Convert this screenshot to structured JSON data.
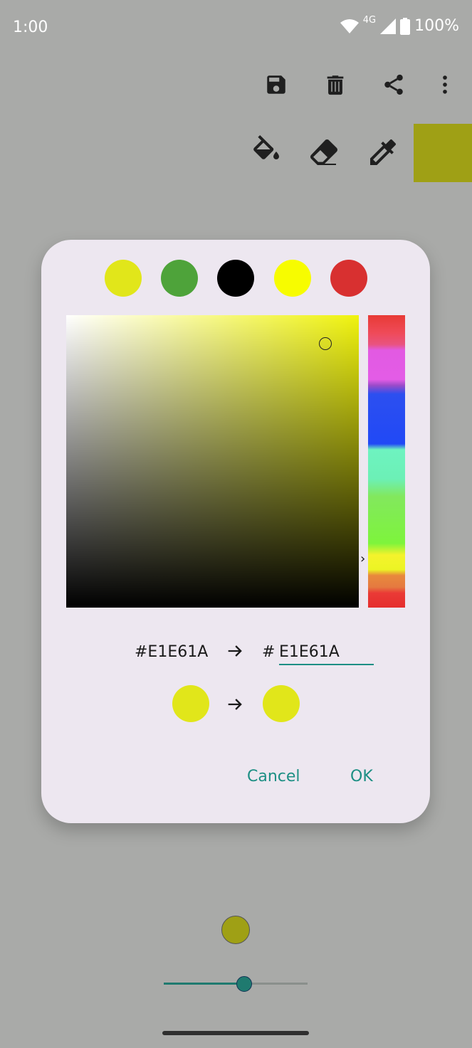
{
  "status_bar": {
    "time": "1:00",
    "network": "4G",
    "battery": "100%"
  },
  "toolbar": {
    "icons": [
      "save-icon",
      "delete-icon",
      "share-icon",
      "more-vert-icon"
    ]
  },
  "tools": {
    "icons": [
      "fill-bucket-icon",
      "eraser-icon",
      "eyedropper-icon"
    ],
    "current_color": "#9fa015"
  },
  "dialog": {
    "presets": [
      "#e1e61a",
      "#4ea33a",
      "#000000",
      "#f7fc00",
      "#d83030"
    ],
    "picker_hue": "#f0f30e",
    "old_hex": "#E1E61A",
    "hash": "#",
    "new_hex": "E1E61A",
    "old_color": "#e1e61a",
    "new_color": "#e1e61a",
    "cancel_label": "Cancel",
    "ok_label": "OK"
  },
  "brush": {
    "color": "#9fa015",
    "size_level": 0.56
  }
}
